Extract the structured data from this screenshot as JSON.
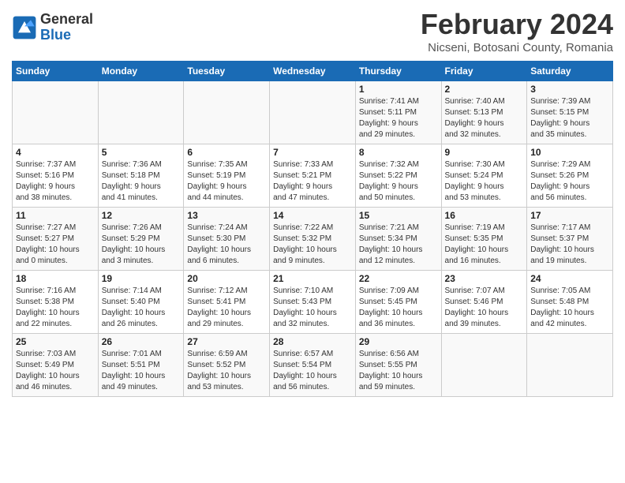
{
  "header": {
    "logo_general": "General",
    "logo_blue": "Blue",
    "month_year": "February 2024",
    "location": "Nicseni, Botosani County, Romania"
  },
  "days_of_week": [
    "Sunday",
    "Monday",
    "Tuesday",
    "Wednesday",
    "Thursday",
    "Friday",
    "Saturday"
  ],
  "weeks": [
    [
      {
        "day": "",
        "content": ""
      },
      {
        "day": "",
        "content": ""
      },
      {
        "day": "",
        "content": ""
      },
      {
        "day": "",
        "content": ""
      },
      {
        "day": "1",
        "content": "Sunrise: 7:41 AM\nSunset: 5:11 PM\nDaylight: 9 hours\nand 29 minutes."
      },
      {
        "day": "2",
        "content": "Sunrise: 7:40 AM\nSunset: 5:13 PM\nDaylight: 9 hours\nand 32 minutes."
      },
      {
        "day": "3",
        "content": "Sunrise: 7:39 AM\nSunset: 5:15 PM\nDaylight: 9 hours\nand 35 minutes."
      }
    ],
    [
      {
        "day": "4",
        "content": "Sunrise: 7:37 AM\nSunset: 5:16 PM\nDaylight: 9 hours\nand 38 minutes."
      },
      {
        "day": "5",
        "content": "Sunrise: 7:36 AM\nSunset: 5:18 PM\nDaylight: 9 hours\nand 41 minutes."
      },
      {
        "day": "6",
        "content": "Sunrise: 7:35 AM\nSunset: 5:19 PM\nDaylight: 9 hours\nand 44 minutes."
      },
      {
        "day": "7",
        "content": "Sunrise: 7:33 AM\nSunset: 5:21 PM\nDaylight: 9 hours\nand 47 minutes."
      },
      {
        "day": "8",
        "content": "Sunrise: 7:32 AM\nSunset: 5:22 PM\nDaylight: 9 hours\nand 50 minutes."
      },
      {
        "day": "9",
        "content": "Sunrise: 7:30 AM\nSunset: 5:24 PM\nDaylight: 9 hours\nand 53 minutes."
      },
      {
        "day": "10",
        "content": "Sunrise: 7:29 AM\nSunset: 5:26 PM\nDaylight: 9 hours\nand 56 minutes."
      }
    ],
    [
      {
        "day": "11",
        "content": "Sunrise: 7:27 AM\nSunset: 5:27 PM\nDaylight: 10 hours\nand 0 minutes."
      },
      {
        "day": "12",
        "content": "Sunrise: 7:26 AM\nSunset: 5:29 PM\nDaylight: 10 hours\nand 3 minutes."
      },
      {
        "day": "13",
        "content": "Sunrise: 7:24 AM\nSunset: 5:30 PM\nDaylight: 10 hours\nand 6 minutes."
      },
      {
        "day": "14",
        "content": "Sunrise: 7:22 AM\nSunset: 5:32 PM\nDaylight: 10 hours\nand 9 minutes."
      },
      {
        "day": "15",
        "content": "Sunrise: 7:21 AM\nSunset: 5:34 PM\nDaylight: 10 hours\nand 12 minutes."
      },
      {
        "day": "16",
        "content": "Sunrise: 7:19 AM\nSunset: 5:35 PM\nDaylight: 10 hours\nand 16 minutes."
      },
      {
        "day": "17",
        "content": "Sunrise: 7:17 AM\nSunset: 5:37 PM\nDaylight: 10 hours\nand 19 minutes."
      }
    ],
    [
      {
        "day": "18",
        "content": "Sunrise: 7:16 AM\nSunset: 5:38 PM\nDaylight: 10 hours\nand 22 minutes."
      },
      {
        "day": "19",
        "content": "Sunrise: 7:14 AM\nSunset: 5:40 PM\nDaylight: 10 hours\nand 26 minutes."
      },
      {
        "day": "20",
        "content": "Sunrise: 7:12 AM\nSunset: 5:41 PM\nDaylight: 10 hours\nand 29 minutes."
      },
      {
        "day": "21",
        "content": "Sunrise: 7:10 AM\nSunset: 5:43 PM\nDaylight: 10 hours\nand 32 minutes."
      },
      {
        "day": "22",
        "content": "Sunrise: 7:09 AM\nSunset: 5:45 PM\nDaylight: 10 hours\nand 36 minutes."
      },
      {
        "day": "23",
        "content": "Sunrise: 7:07 AM\nSunset: 5:46 PM\nDaylight: 10 hours\nand 39 minutes."
      },
      {
        "day": "24",
        "content": "Sunrise: 7:05 AM\nSunset: 5:48 PM\nDaylight: 10 hours\nand 42 minutes."
      }
    ],
    [
      {
        "day": "25",
        "content": "Sunrise: 7:03 AM\nSunset: 5:49 PM\nDaylight: 10 hours\nand 46 minutes."
      },
      {
        "day": "26",
        "content": "Sunrise: 7:01 AM\nSunset: 5:51 PM\nDaylight: 10 hours\nand 49 minutes."
      },
      {
        "day": "27",
        "content": "Sunrise: 6:59 AM\nSunset: 5:52 PM\nDaylight: 10 hours\nand 53 minutes."
      },
      {
        "day": "28",
        "content": "Sunrise: 6:57 AM\nSunset: 5:54 PM\nDaylight: 10 hours\nand 56 minutes."
      },
      {
        "day": "29",
        "content": "Sunrise: 6:56 AM\nSunset: 5:55 PM\nDaylight: 10 hours\nand 59 minutes."
      },
      {
        "day": "",
        "content": ""
      },
      {
        "day": "",
        "content": ""
      }
    ]
  ]
}
